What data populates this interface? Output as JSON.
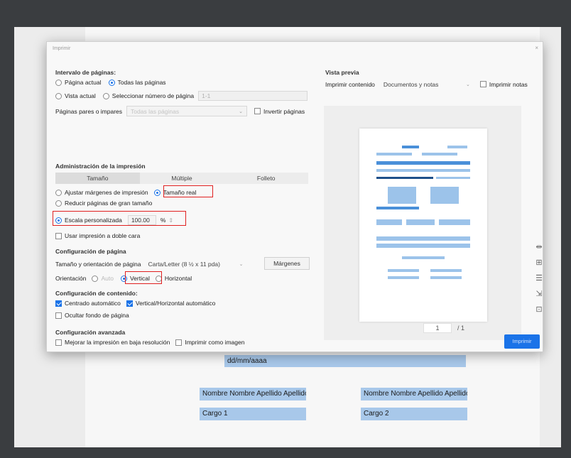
{
  "dialog": {
    "title": "Imprimir",
    "close_label": "×"
  },
  "page_range": {
    "title": "Intervalo de páginas:",
    "current_page": "Página actual",
    "all_pages": "Todas las páginas",
    "current_view": "Vista actual",
    "select_pages": "Seleccionar número de página",
    "page_number_placeholder": "1-1",
    "odd_even_label": "Páginas pares o impares",
    "odd_even_value": "Todas las páginas",
    "invert_pages": "Invertir páginas"
  },
  "print_admin": {
    "title": "Administración de la impresión",
    "tabs": [
      "Tamaño",
      "Múltiple",
      "Folleto"
    ],
    "fit_margins": "Ajustar márgenes de impresión",
    "actual_size": "Tamaño real",
    "shrink_large": "Reducir páginas de gran tamaño",
    "custom_scale": "Escala personalizada",
    "scale_value": "100.00",
    "scale_unit": "%",
    "duplex": "Usar impresión a doble cara"
  },
  "page_setup": {
    "title": "Configuración de página",
    "size_label": "Tamaño y orientación de página",
    "size_value": "Carta/Letter (8 ½ x 11 pda)",
    "margins_button": "Márgenes",
    "orientation_label": "Orientación",
    "auto": "Auto",
    "vertical": "Vertical",
    "horizontal": "Horizontal"
  },
  "content_setup": {
    "title": "Configuración de contenido:",
    "auto_center": "Centrado automático",
    "auto_rotate": "Vertical/Horizontal automático",
    "hide_background": "Ocultar fondo de página"
  },
  "advanced": {
    "title": "Configuración avanzada",
    "low_res": "Mejorar la impresión en baja resolución",
    "as_image": "Imprimir como imagen"
  },
  "preview": {
    "title": "Vista previa",
    "print_content_label": "Imprimir contenido",
    "print_content_value": "Documentos y notas",
    "print_notes": "Imprimir notas",
    "current_page": "1",
    "total_pages": "/ 1",
    "side_icons": [
      "fit-width-icon",
      "page-add-icon",
      "page-list-icon",
      "page-export-icon",
      "page-fit-icon"
    ]
  },
  "print_button": "Imprimir",
  "document": {
    "date_field": "dd/mm/aaaa",
    "signer1_name": "Nombre Nombre Apellido Apellido",
    "signer1_role": "Cargo 1",
    "signer2_name": "Nombre Nombre Apellido Apellido",
    "signer2_role": "Cargo 2"
  },
  "colors": {
    "accent": "#1a73e8",
    "highlight": "#e02020",
    "field_fill": "#a8c8ea",
    "backdrop": "#3a3d40"
  }
}
